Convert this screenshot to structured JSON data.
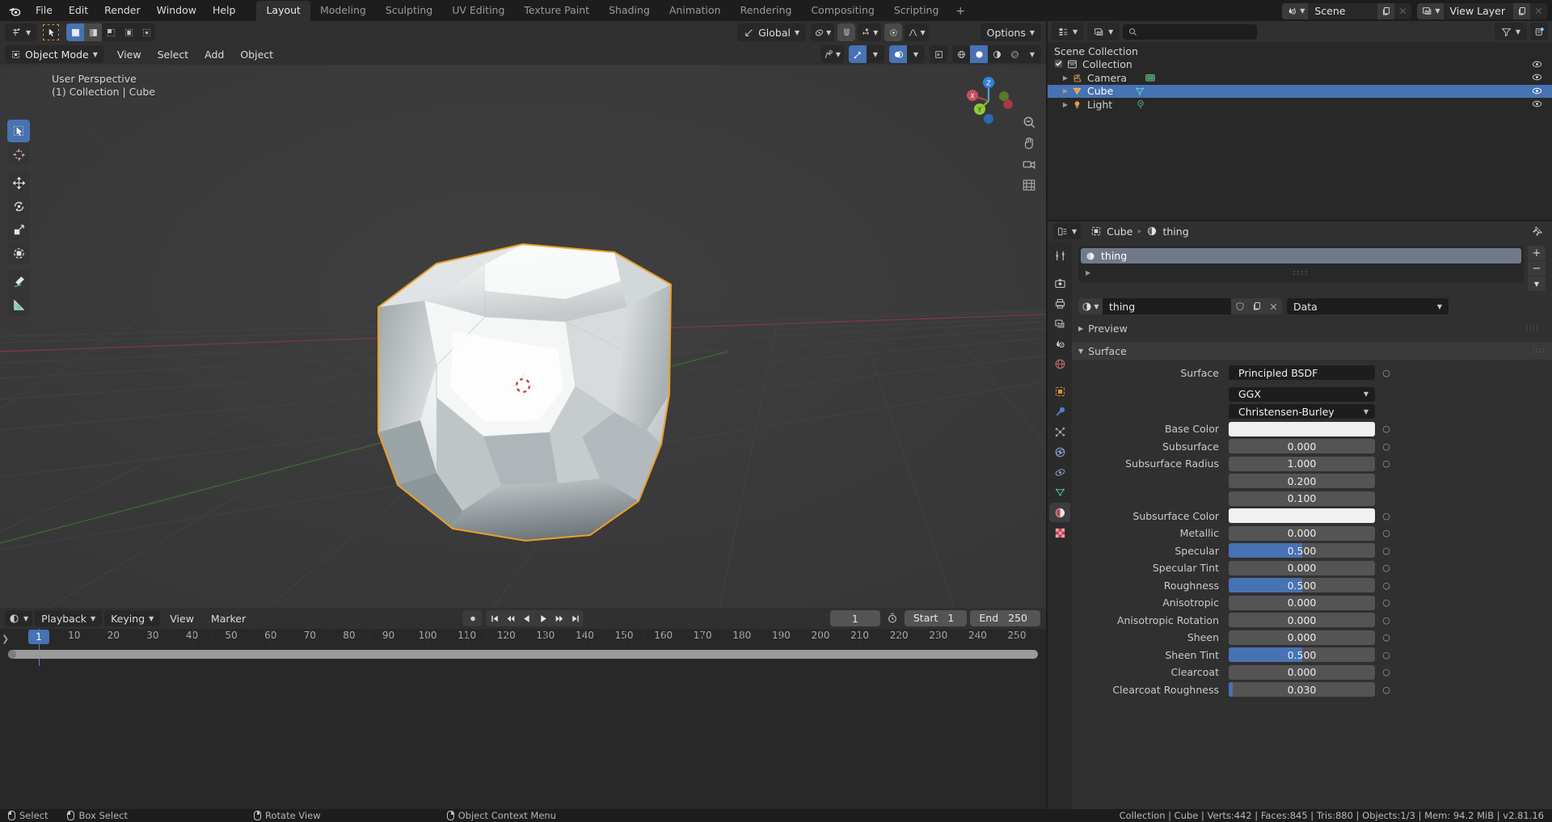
{
  "app": {
    "name": "Blender",
    "version_label": "v2.81.16"
  },
  "topbar": {
    "menus": [
      "File",
      "Edit",
      "Render",
      "Window",
      "Help"
    ],
    "workspace_tabs": [
      {
        "label": "Layout",
        "active": true
      },
      {
        "label": "Modeling",
        "active": false
      },
      {
        "label": "Sculpting",
        "active": false
      },
      {
        "label": "UV Editing",
        "active": false
      },
      {
        "label": "Texture Paint",
        "active": false
      },
      {
        "label": "Shading",
        "active": false
      },
      {
        "label": "Animation",
        "active": false
      },
      {
        "label": "Rendering",
        "active": false
      },
      {
        "label": "Compositing",
        "active": false
      },
      {
        "label": "Scripting",
        "active": false
      }
    ],
    "add_workspace_label": "+",
    "scene_name": "Scene",
    "view_layer_name": "View Layer"
  },
  "viewport_header": {
    "transform_orientation": "Global",
    "options_label": "Options",
    "mode": "Object Mode",
    "menus": [
      "View",
      "Select",
      "Add",
      "Object"
    ]
  },
  "viewport": {
    "perspective_label": "User Perspective",
    "scene_label": "(1) Collection | Cube",
    "gizmo_axes": [
      "X",
      "Y",
      "Z"
    ],
    "tools": [
      {
        "name": "tweak-tool",
        "active": true
      },
      {
        "name": "cursor-tool",
        "active": false
      },
      {
        "name": "move-tool",
        "active": false
      },
      {
        "name": "rotate-tool",
        "active": false
      },
      {
        "name": "scale-tool",
        "active": false
      },
      {
        "name": "transform-tool",
        "active": false
      },
      {
        "name": "annotate-tool",
        "active": false
      },
      {
        "name": "measure-tool",
        "active": false
      }
    ]
  },
  "outliner": {
    "search_placeholder": "",
    "root_label": "Scene Collection",
    "items": [
      {
        "label": "Collection",
        "type": "collection",
        "depth": 0,
        "selected": false,
        "checkbox": true
      },
      {
        "label": "Camera",
        "type": "camera",
        "depth": 1,
        "selected": false,
        "checkbox": false
      },
      {
        "label": "Cube",
        "type": "mesh",
        "depth": 1,
        "selected": true,
        "checkbox": false
      },
      {
        "label": "Light",
        "type": "light",
        "depth": 1,
        "selected": false,
        "checkbox": false
      }
    ]
  },
  "properties": {
    "breadcrumb": [
      "Cube",
      "thing"
    ],
    "material_slots": [
      {
        "label": "thing",
        "selected": true
      }
    ],
    "material_name": "thing",
    "data_dropdown": "Data",
    "panels": [
      {
        "label": "Preview",
        "open": false
      },
      {
        "label": "Surface",
        "open": true
      }
    ],
    "surface": {
      "surface_label": "Surface",
      "surface_value": "Principled BSDF",
      "distribution": "GGX",
      "subsurface_method": "Christensen-Burley",
      "rows": [
        {
          "label": "Base Color",
          "type": "color",
          "color": "#f0efed"
        },
        {
          "label": "Subsurface",
          "type": "value",
          "value": "0.000",
          "fill": 0.0
        },
        {
          "label": "Subsurface Radius",
          "type": "vector",
          "values": [
            "1.000",
            "0.200",
            "0.100"
          ]
        },
        {
          "label": "Subsurface Color",
          "type": "color",
          "color": "#f2f1ef"
        },
        {
          "label": "Metallic",
          "type": "value",
          "value": "0.000",
          "fill": 0.0
        },
        {
          "label": "Specular",
          "type": "value",
          "value": "0.500",
          "fill": 0.5
        },
        {
          "label": "Specular Tint",
          "type": "value",
          "value": "0.000",
          "fill": 0.0
        },
        {
          "label": "Roughness",
          "type": "value",
          "value": "0.500",
          "fill": 0.5
        },
        {
          "label": "Anisotropic",
          "type": "value",
          "value": "0.000",
          "fill": 0.0
        },
        {
          "label": "Anisotropic Rotation",
          "type": "value",
          "value": "0.000",
          "fill": 0.0
        },
        {
          "label": "Sheen",
          "type": "value",
          "value": "0.000",
          "fill": 0.0
        },
        {
          "label": "Sheen Tint",
          "type": "value",
          "value": "0.500",
          "fill": 0.5
        },
        {
          "label": "Clearcoat",
          "type": "value",
          "value": "0.000",
          "fill": 0.0
        },
        {
          "label": "Clearcoat Roughness",
          "type": "value",
          "value": "0.030",
          "fill": 0.03
        }
      ]
    },
    "tabs": [
      {
        "name": "tool-tab",
        "active": false
      },
      {
        "name": "render-tab",
        "active": false
      },
      {
        "name": "output-tab",
        "active": false
      },
      {
        "name": "view-layer-tab",
        "active": false
      },
      {
        "name": "scene-tab",
        "active": false
      },
      {
        "name": "world-tab",
        "active": false
      },
      {
        "name": "object-tab",
        "active": false
      },
      {
        "name": "modifier-tab",
        "active": false
      },
      {
        "name": "particles-tab",
        "active": false
      },
      {
        "name": "physics-tab",
        "active": false
      },
      {
        "name": "constraints-tab",
        "active": false
      },
      {
        "name": "object-data-tab",
        "active": false
      },
      {
        "name": "material-tab",
        "active": true
      },
      {
        "name": "texture-tab",
        "active": false
      }
    ]
  },
  "timeline": {
    "menus": [
      "Playback",
      "Keying",
      "View",
      "Marker"
    ],
    "current_frame": "1",
    "start_label": "Start",
    "start_value": "1",
    "end_label": "End",
    "end_value": "250",
    "ticks": [
      10,
      20,
      30,
      40,
      50,
      60,
      70,
      80,
      90,
      100,
      110,
      120,
      130,
      140,
      150,
      160,
      170,
      180,
      190,
      200,
      210,
      220,
      230,
      240,
      250
    ],
    "playhead_frame": 1
  },
  "statusbar": {
    "hints": [
      {
        "mouse": "left",
        "label": "Select"
      },
      {
        "mouse": "left-drag",
        "label": "Box Select"
      },
      {
        "mouse": "middle",
        "label": "Rotate View"
      },
      {
        "mouse": "right",
        "label": "Object Context Menu"
      }
    ],
    "info": "Collection | Cube | Verts:442 | Faces:845 | Tris:880 | Objects:1/3 | Mem: 94.2 MiB | v2.81.16"
  }
}
